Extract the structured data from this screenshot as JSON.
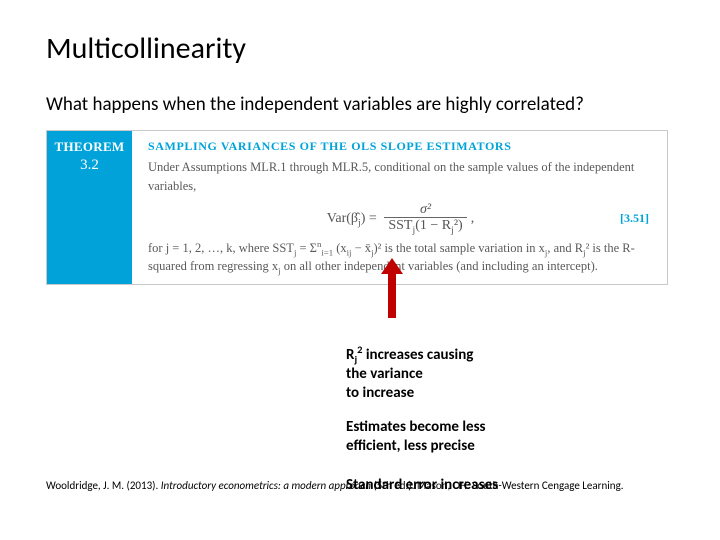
{
  "title": "Multicollinearity",
  "lead": "What happens when the independent variables are highly correlated?",
  "theorem": {
    "label": "THEOREM",
    "num": "3.2",
    "heading": "SAMPLING VARIANCES OF THE OLS SLOPE ESTIMATORS",
    "line1": "Under Assumptions MLR.1 through MLR.5, conditional on the sample values of the independent variables,",
    "eq_lhs": "Var(β̂",
    "eq_lhs_sub": "j",
    "eq_lhs_tail": ") =",
    "eq_num": "σ²",
    "eq_den_a": "SST",
    "eq_den_a_sub": "j",
    "eq_den_b": "(1 − R",
    "eq_den_b_sub": "j",
    "eq_den_b_tail": "²)",
    "eq_comma": ",",
    "eq_ref": "[3.51]",
    "line2a": "for j = 1, 2, …, k, where SST",
    "line2a_sub": "j",
    "line2b": " = Σ",
    "line2b_sup": "n",
    "line2b_sub": "i=1",
    "line2c": " (x",
    "line2c_sub": "ij",
    "line2d": " − x̄",
    "line2d_sub": "j",
    "line2e": ")² is the total sample variation in x",
    "line2e_sub": "j",
    "line2f": ", and R",
    "line2f_sub": "j",
    "line2g": "² is the R-squared from regressing x",
    "line2g_sub": "j",
    "line2h": " on all other independent variables (and including an intercept)."
  },
  "annot": {
    "r_label_a": "R",
    "r_label_sub": "j",
    "r_label_sup": "2",
    "r_label_b": " increases causing",
    "line2": "the variance",
    "line3": "to increase",
    "block2a": "Estimates become less",
    "block2b": "efficient, less precise",
    "block3": "Standard error increases"
  },
  "citation": {
    "a": "Wooldridge, J. M. (2013). ",
    "i": "Introductory econometrics: a modern approach",
    "b": " (5th ed.). Mason, OH: South-Western Cengage Learning."
  }
}
